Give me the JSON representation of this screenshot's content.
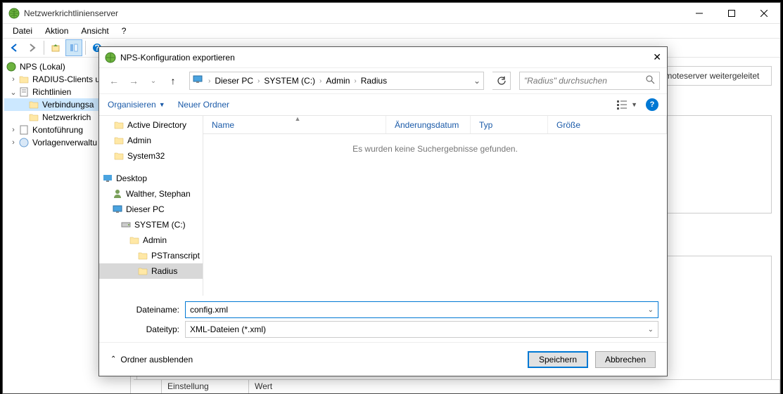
{
  "window": {
    "title": "Netzwerkrichtlinienserver"
  },
  "menu": {
    "file": "Datei",
    "action": "Aktion",
    "view": "Ansicht",
    "help": "?"
  },
  "tree": {
    "root": "NPS (Lokal)",
    "radius_clients": "RADIUS-Clients u",
    "policies": "Richtlinien",
    "conn_policies": "Verbindungsa",
    "net_policies": "Netzwerkrich",
    "accounting": "Kontoführung",
    "templates": "Vorlagenverwaltu"
  },
  "content": {
    "remote_hint": "-Remoteserver weitergeleitet"
  },
  "bottom": {
    "col1": "Einstellung",
    "col2": "Wert"
  },
  "dialog": {
    "title": "NPS-Konfiguration exportieren",
    "breadcrumb": {
      "pc": "Dieser PC",
      "drive": "SYSTEM (C:)",
      "admin": "Admin",
      "radius": "Radius"
    },
    "search_placeholder": "\"Radius\" durchsuchen",
    "toolbar": {
      "organize": "Organisieren",
      "new_folder": "Neuer Ordner"
    },
    "tree": {
      "ad": "Active Directory",
      "admin": "Admin",
      "system32": "System32",
      "desktop": "Desktop",
      "user": "Walther, Stephan",
      "this_pc": "Dieser PC",
      "drive": "SYSTEM (C:)",
      "admin2": "Admin",
      "pstranscript": "PSTranscript",
      "radius": "Radius"
    },
    "list": {
      "col_name": "Name",
      "col_date": "Änderungsdatum",
      "col_type": "Typ",
      "col_size": "Größe",
      "empty": "Es wurden keine Suchergebnisse gefunden."
    },
    "fields": {
      "filename_label": "Dateiname:",
      "filename_value": "config.xml",
      "filetype_label": "Dateityp:",
      "filetype_value": "XML-Dateien (*.xml)"
    },
    "footer": {
      "hide_folders": "Ordner ausblenden",
      "save": "Speichern",
      "cancel": "Abbrechen"
    }
  }
}
